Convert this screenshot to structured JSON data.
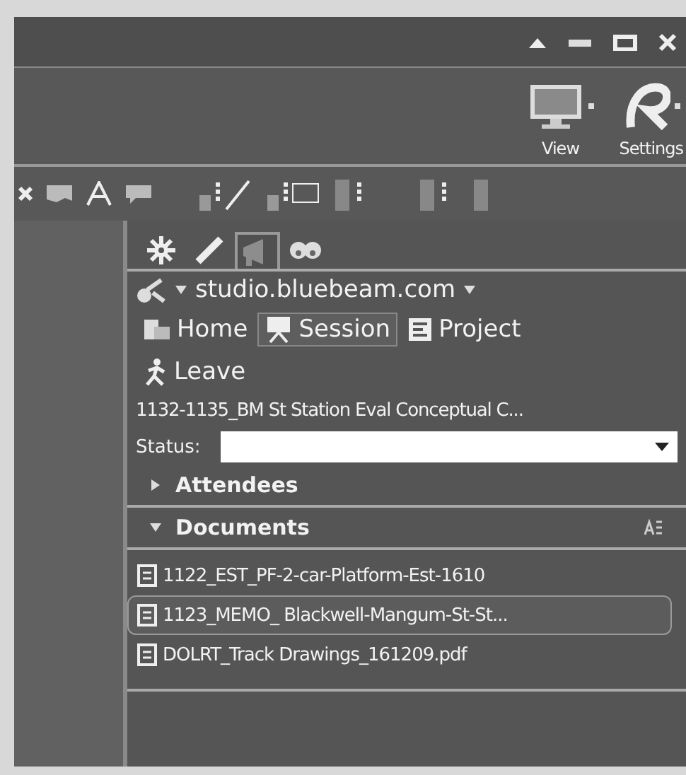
{
  "ribbon": {
    "buttons": [
      {
        "label": "View",
        "kind": "monitor"
      },
      {
        "label": "Settings",
        "kind": "logo"
      }
    ]
  },
  "panel": {
    "tabs": [
      {
        "kind": "gear",
        "selected": false
      },
      {
        "kind": "pencil",
        "selected": false
      },
      {
        "kind": "megaphone",
        "selected": true
      },
      {
        "kind": "studio",
        "selected": false
      }
    ],
    "server": "studio.bluebeam.com",
    "nav": [
      {
        "label": "Home",
        "kind": "home",
        "selected": false
      },
      {
        "label": "Session",
        "kind": "session",
        "selected": true
      },
      {
        "label": "Project",
        "kind": "project",
        "selected": false
      }
    ],
    "leave": "Leave",
    "session_title": "1132-1135_BM St Station Eval Conceptual C...",
    "status": {
      "label": "Status:"
    },
    "sections": [
      {
        "title": "Attendees",
        "expanded": false
      },
      {
        "title": "Documents",
        "expanded": true,
        "documents": [
          {
            "name": "1122_EST_PF-2-car-Platform-Est-1610",
            "selected": false
          },
          {
            "name": "1123_MEMO_ Blackwell-Mangum-St-St...",
            "selected": true
          },
          {
            "name": "DOLRT_Track Drawings_161209.pdf",
            "selected": false
          }
        ]
      }
    ]
  }
}
